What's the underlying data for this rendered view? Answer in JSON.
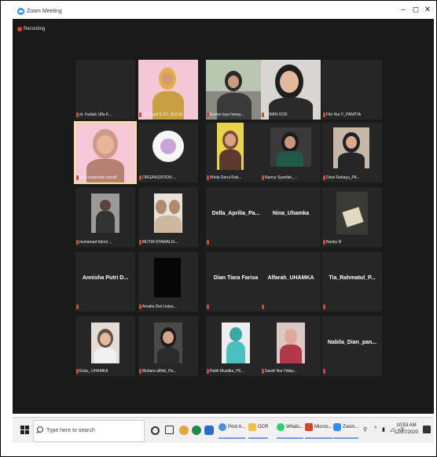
{
  "window": {
    "title": "Zoom Meeting",
    "minimize": "–",
    "maximize": "◻",
    "close": "✕"
  },
  "recording": {
    "label": "Recording"
  },
  "participants": [
    {
      "name": "dr. Fadiah Ulfa K...",
      "video": false
    },
    {
      "name": "Ri Hayati S.ST., M.K.M",
      "video": true
    },
    {
      "name": "Ervina Isya Ismay...",
      "video": true
    },
    {
      "name": "ADMIN OCR",
      "video": true
    },
    {
      "name": "Fitri Nur F_PANITIA",
      "video": false
    },
    {
      "name": "putri wulandari hanafi",
      "video": true
    },
    {
      "name": "ORGANIZATION ...",
      "video": true
    },
    {
      "name": "Wiola Derul Rah...",
      "video": true
    },
    {
      "name": "Nanny Syarifah_...",
      "video": true
    },
    {
      "name": "Dewi Rahayu_PA...",
      "video": true
    },
    {
      "name": "muhamad fahrul ...",
      "video": true
    },
    {
      "name": "MUTIA SYAWALIS...",
      "video": true
    },
    {
      "name": "Della_Aprilia_Pa...",
      "video": false
    },
    {
      "name": "Nina_Uhamka",
      "video": false
    },
    {
      "name": "Nunky N",
      "video": true
    },
    {
      "name": "Annisha Putri D...",
      "video": false
    },
    {
      "name": "Amalia Dwi Listya...",
      "video": true
    },
    {
      "name": "Dian Tiara Farisa",
      "video": false
    },
    {
      "name": "Alfarah_UHAMKA",
      "video": false
    },
    {
      "name": "Tia_Rahmatul_P...",
      "video": false
    },
    {
      "name": "Elvia_ UHAMKA",
      "video": true
    },
    {
      "name": "Mutiara afifah_Pa...",
      "video": true
    },
    {
      "name": "Ratih Mustika_PE...",
      "video": true
    },
    {
      "name": "Sarah Nur Hiday...",
      "video": true
    },
    {
      "name": "Nabila_Dian_pan...",
      "video": false
    }
  ],
  "taskbar": {
    "search_placeholder": "Type here to search",
    "apps": [
      {
        "label": "Post A...",
        "icon": "chrome-icon"
      },
      {
        "label": "OCR",
        "icon": "folder-icon"
      },
      {
        "label": "Whats...",
        "icon": "whatsapp-icon"
      },
      {
        "label": "Micros...",
        "icon": "powerpoint-icon"
      },
      {
        "label": "Zoom...",
        "icon": "zoom-icon"
      }
    ],
    "time": "10:53 AM",
    "date": "12/27/2020"
  },
  "colors": {
    "accent": "#2d8cff",
    "recording": "#e8402c",
    "active_speaker": "#f4e39a",
    "tile_bg": "#262626"
  }
}
